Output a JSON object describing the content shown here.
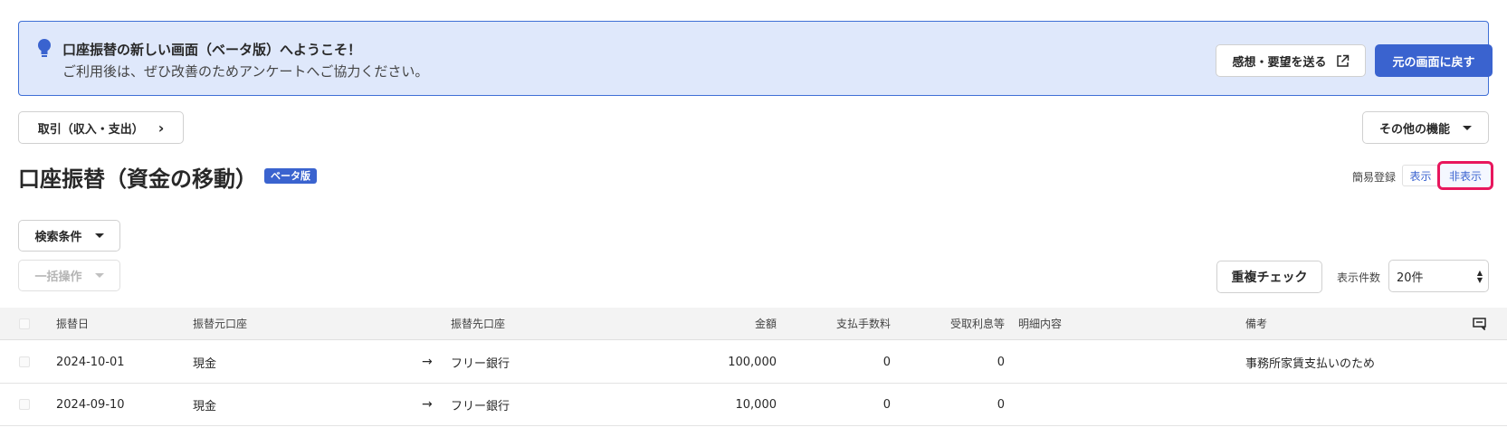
{
  "banner": {
    "title": "口座振替の新しい画面（ベータ版）へようこそ！",
    "subtitle": "ご利用後は、ぜひ改善のためアンケートへご協力ください。",
    "feedback_label": "感想・要望を送る",
    "back_label": "元の画面に戻す",
    "accent": "#3a63cf"
  },
  "breadcrumb": {
    "label": "取引（収入・支出）"
  },
  "other_menu": {
    "label": "その他の機能"
  },
  "page": {
    "title": "口座振替（資金の移動）",
    "badge": "ベータ版"
  },
  "quick_register": {
    "label": "簡易登録",
    "show": "表示",
    "hide": "非表示",
    "highlight": "#e8175d"
  },
  "toolbar": {
    "search_label": "検索条件",
    "bulk_label": "一括操作",
    "duplicate_label": "重複チェック",
    "count_label": "表示件数",
    "count_value": "20件"
  },
  "table": {
    "headers": {
      "date": "振替日",
      "from": "振替元口座",
      "to": "振替先口座",
      "amount": "金額",
      "fee": "支払手数料",
      "interest": "受取利息等",
      "details": "明細内容",
      "memo": "備考"
    },
    "rows": [
      {
        "date": "2024-10-01",
        "from": "現金",
        "arrow": "→",
        "to": "フリー銀行",
        "amount": "100,000",
        "fee": "0",
        "interest": "0",
        "details": "",
        "memo": "事務所家賃支払いのため"
      },
      {
        "date": "2024-09-10",
        "from": "現金",
        "arrow": "→",
        "to": "フリー銀行",
        "amount": "10,000",
        "fee": "0",
        "interest": "0",
        "details": "",
        "memo": ""
      }
    ]
  }
}
